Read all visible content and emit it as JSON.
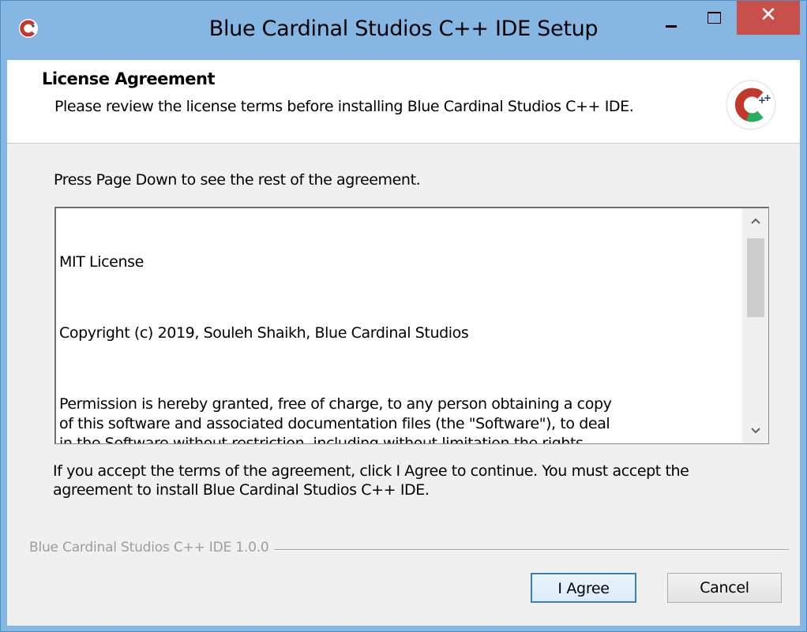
{
  "window": {
    "title": "Blue Cardinal Studios C++ IDE Setup",
    "buttons": {
      "minimize_icon": "minimize-icon",
      "maximize_icon": "maximize-icon",
      "close_symbol": "✕"
    },
    "colors": {
      "titlebar": "#86b6e2",
      "close_button": "#c7504b"
    }
  },
  "header": {
    "title": "License Agreement",
    "subtitle": "Please review the license terms before installing Blue Cardinal Studios C++ IDE.",
    "logo_icon": "cpp-logo-icon"
  },
  "body": {
    "instruction": "Press Page Down to see the rest of the agreement.",
    "license_paragraphs": [
      "MIT License",
      "Copyright (c) 2019, Souleh Shaikh, Blue Cardinal Studios",
      "Permission is hereby granted, free of charge, to any person obtaining a copy\nof this software and associated documentation files (the \"Software\"), to deal\nin the Software without restriction, including without limitation the rights\nto use, copy, modify, merge, publish, distribute, sublicense, and/or sell\ncopies of the Software, and to permit persons to whom the Software is\nfurnished to do so, subject to the following conditions:"
    ],
    "scroll_up_symbol": "^",
    "scroll_down_symbol": "v",
    "accept_text": "If you accept the terms of the agreement, click I Agree to continue. You must accept the agreement to install Blue Cardinal Studios C++ IDE."
  },
  "footer": {
    "branding": "Blue Cardinal Studios C++ IDE 1.0.0",
    "agree_label": "I Agree",
    "cancel_label": "Cancel"
  }
}
